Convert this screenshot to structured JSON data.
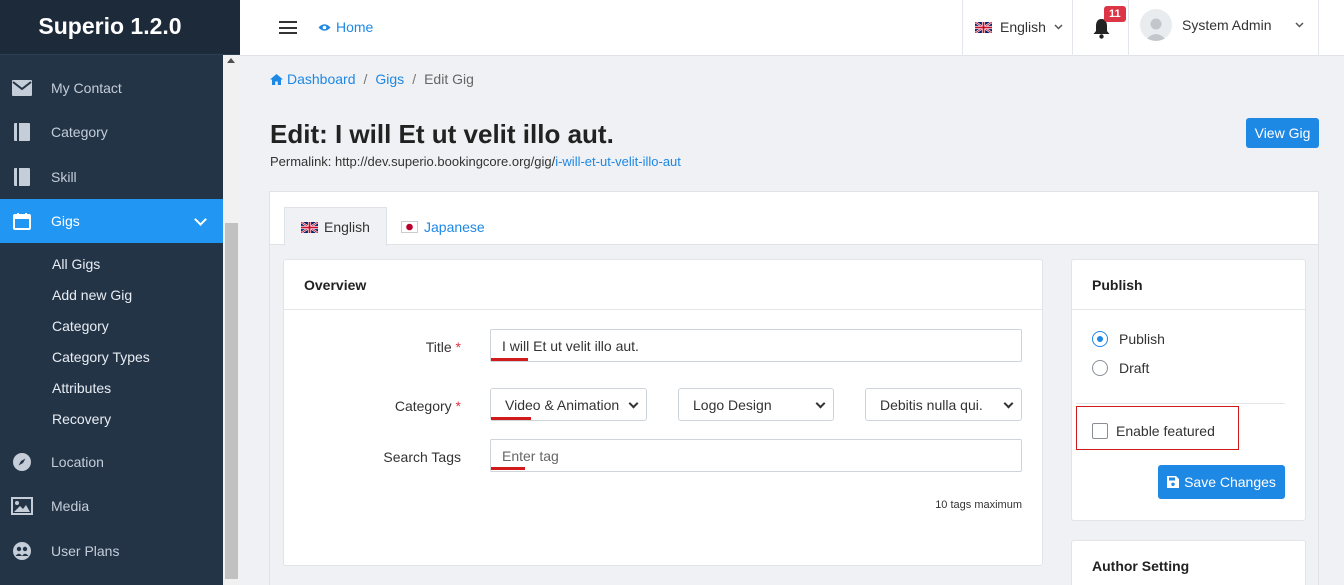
{
  "brand": "Superio 1.2.0",
  "sidebar": {
    "items": [
      {
        "label": "My Contact",
        "icon": "envelope-icon"
      },
      {
        "label": "Category",
        "icon": "book-icon"
      },
      {
        "label": "Skill",
        "icon": "book-icon"
      },
      {
        "label": "Gigs",
        "icon": "calendar-icon",
        "active": true
      },
      {
        "label": "Location",
        "icon": "compass-icon"
      },
      {
        "label": "Media",
        "icon": "image-icon"
      },
      {
        "label": "User Plans",
        "icon": "users-icon"
      }
    ],
    "gigs_sub": [
      "All Gigs",
      "Add new Gig",
      "Category",
      "Category Types",
      "Attributes",
      "Recovery"
    ]
  },
  "topbar": {
    "home": "Home",
    "language": "English",
    "notification_count": "11",
    "user_name": "System Admin"
  },
  "breadcrumb": {
    "dashboard": "Dashboard",
    "gigs": "Gigs",
    "current": "Edit Gig"
  },
  "page": {
    "title": "Edit: I will Et ut velit illo aut.",
    "permalink_prefix": "Permalink: http://dev.superio.bookingcore.org/gig/",
    "permalink_slug": "i-will-et-ut-velit-illo-aut",
    "view_button": "View Gig"
  },
  "tabs": [
    "English",
    "Japanese"
  ],
  "overview": {
    "header": "Overview",
    "title_label": "Title",
    "required_mark": "*",
    "title_value": "I will Et ut velit illo aut.",
    "category_label": "Category",
    "category_values": [
      "Video & Animation",
      "Logo Design",
      "Debitis nulla qui."
    ],
    "tags_label": "Search Tags",
    "tags_placeholder": "Enter tag",
    "tags_hint": "10 tags maximum"
  },
  "publish": {
    "header": "Publish",
    "options": [
      "Publish",
      "Draft"
    ],
    "selected": "Publish",
    "featured_label": "Enable featured",
    "save_button": "Save Changes"
  },
  "author": {
    "header": "Author Setting"
  },
  "colors": {
    "sidebar": "#243447",
    "accent": "#1e88e5",
    "active_nav": "#2196f3",
    "highlight": "#d11a1a"
  }
}
